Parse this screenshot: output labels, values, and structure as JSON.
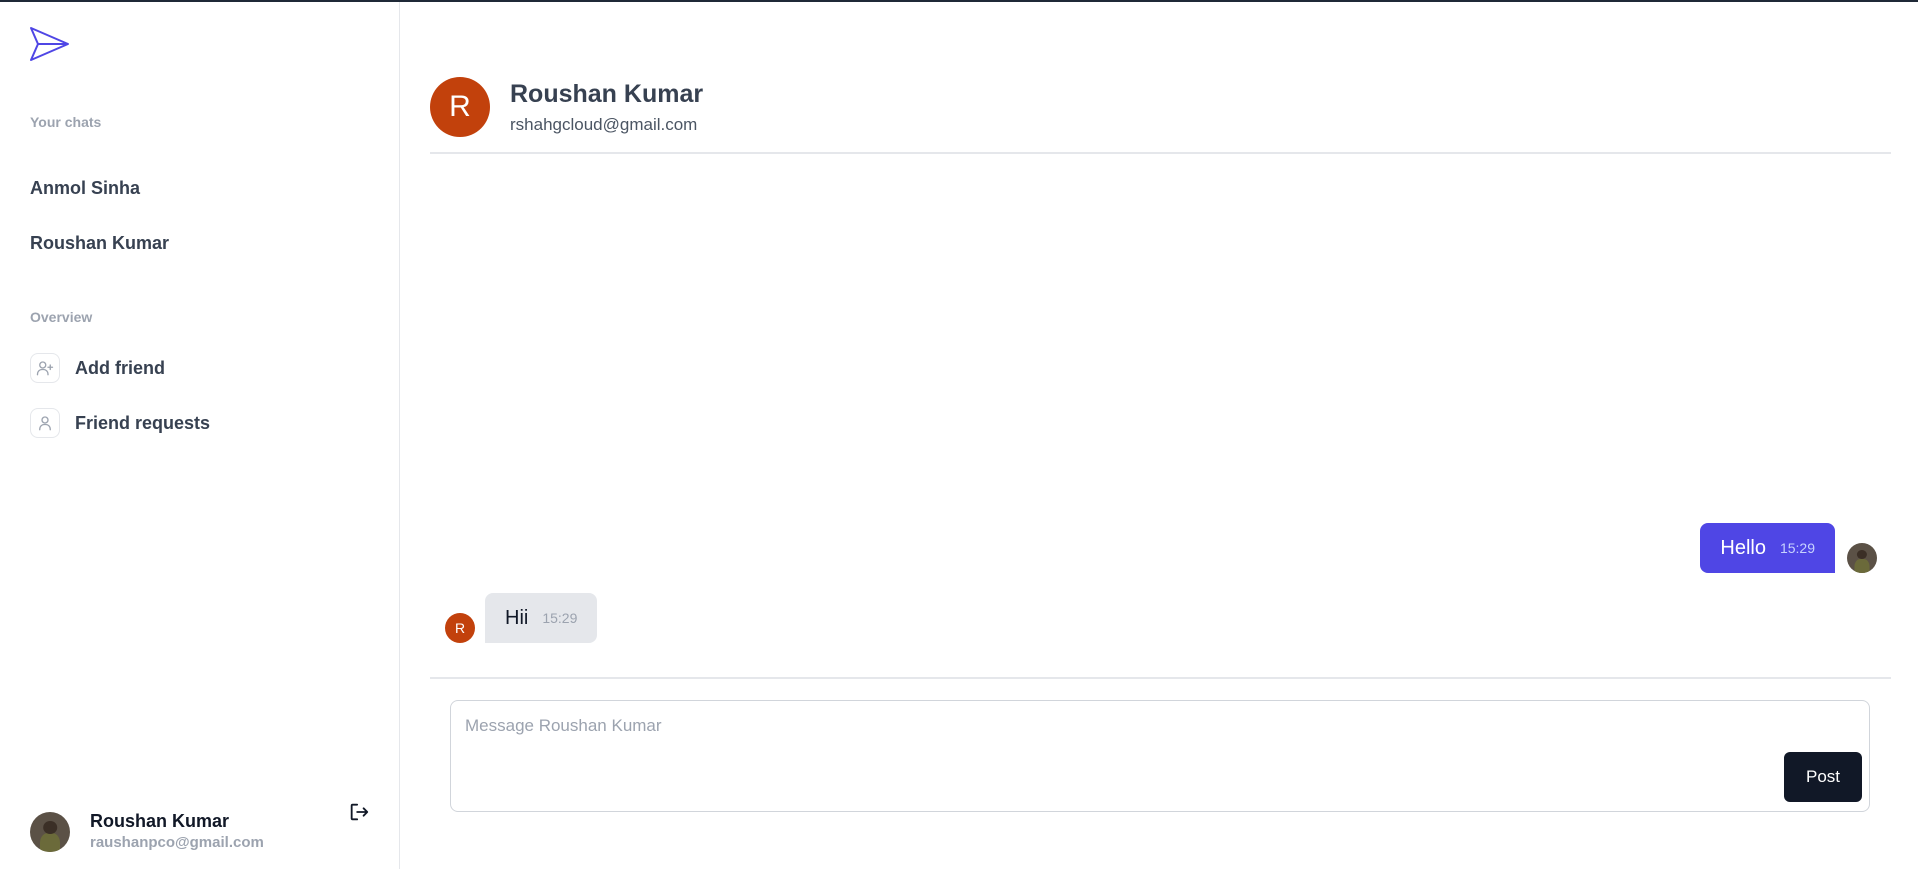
{
  "sidebar": {
    "your_chats_label": "Your chats",
    "chats": [
      {
        "name": "Anmol Sinha"
      },
      {
        "name": "Roushan Kumar"
      }
    ],
    "overview_label": "Overview",
    "overview": [
      {
        "label": "Add friend",
        "icon": "user-plus-icon"
      },
      {
        "label": "Friend requests",
        "icon": "user-icon"
      }
    ],
    "profile": {
      "name": "Roushan Kumar",
      "email": "raushanpco@gmail.com"
    }
  },
  "chat": {
    "partner_initial": "R",
    "partner_name": "Roushan Kumar",
    "partner_email": "rshahgcloud@gmail.com",
    "messages": [
      {
        "direction": "sent",
        "text": "Hello",
        "time": "15:29"
      },
      {
        "direction": "received",
        "text": "Hii",
        "time": "15:29",
        "avatar_initial": "R"
      }
    ],
    "composer": {
      "placeholder": "Message Roushan Kumar",
      "value": "",
      "post_label": "Post"
    }
  },
  "colors": {
    "accent": "#4f46e5",
    "avatar_bg": "#c2410c",
    "post_button": "#111827"
  }
}
